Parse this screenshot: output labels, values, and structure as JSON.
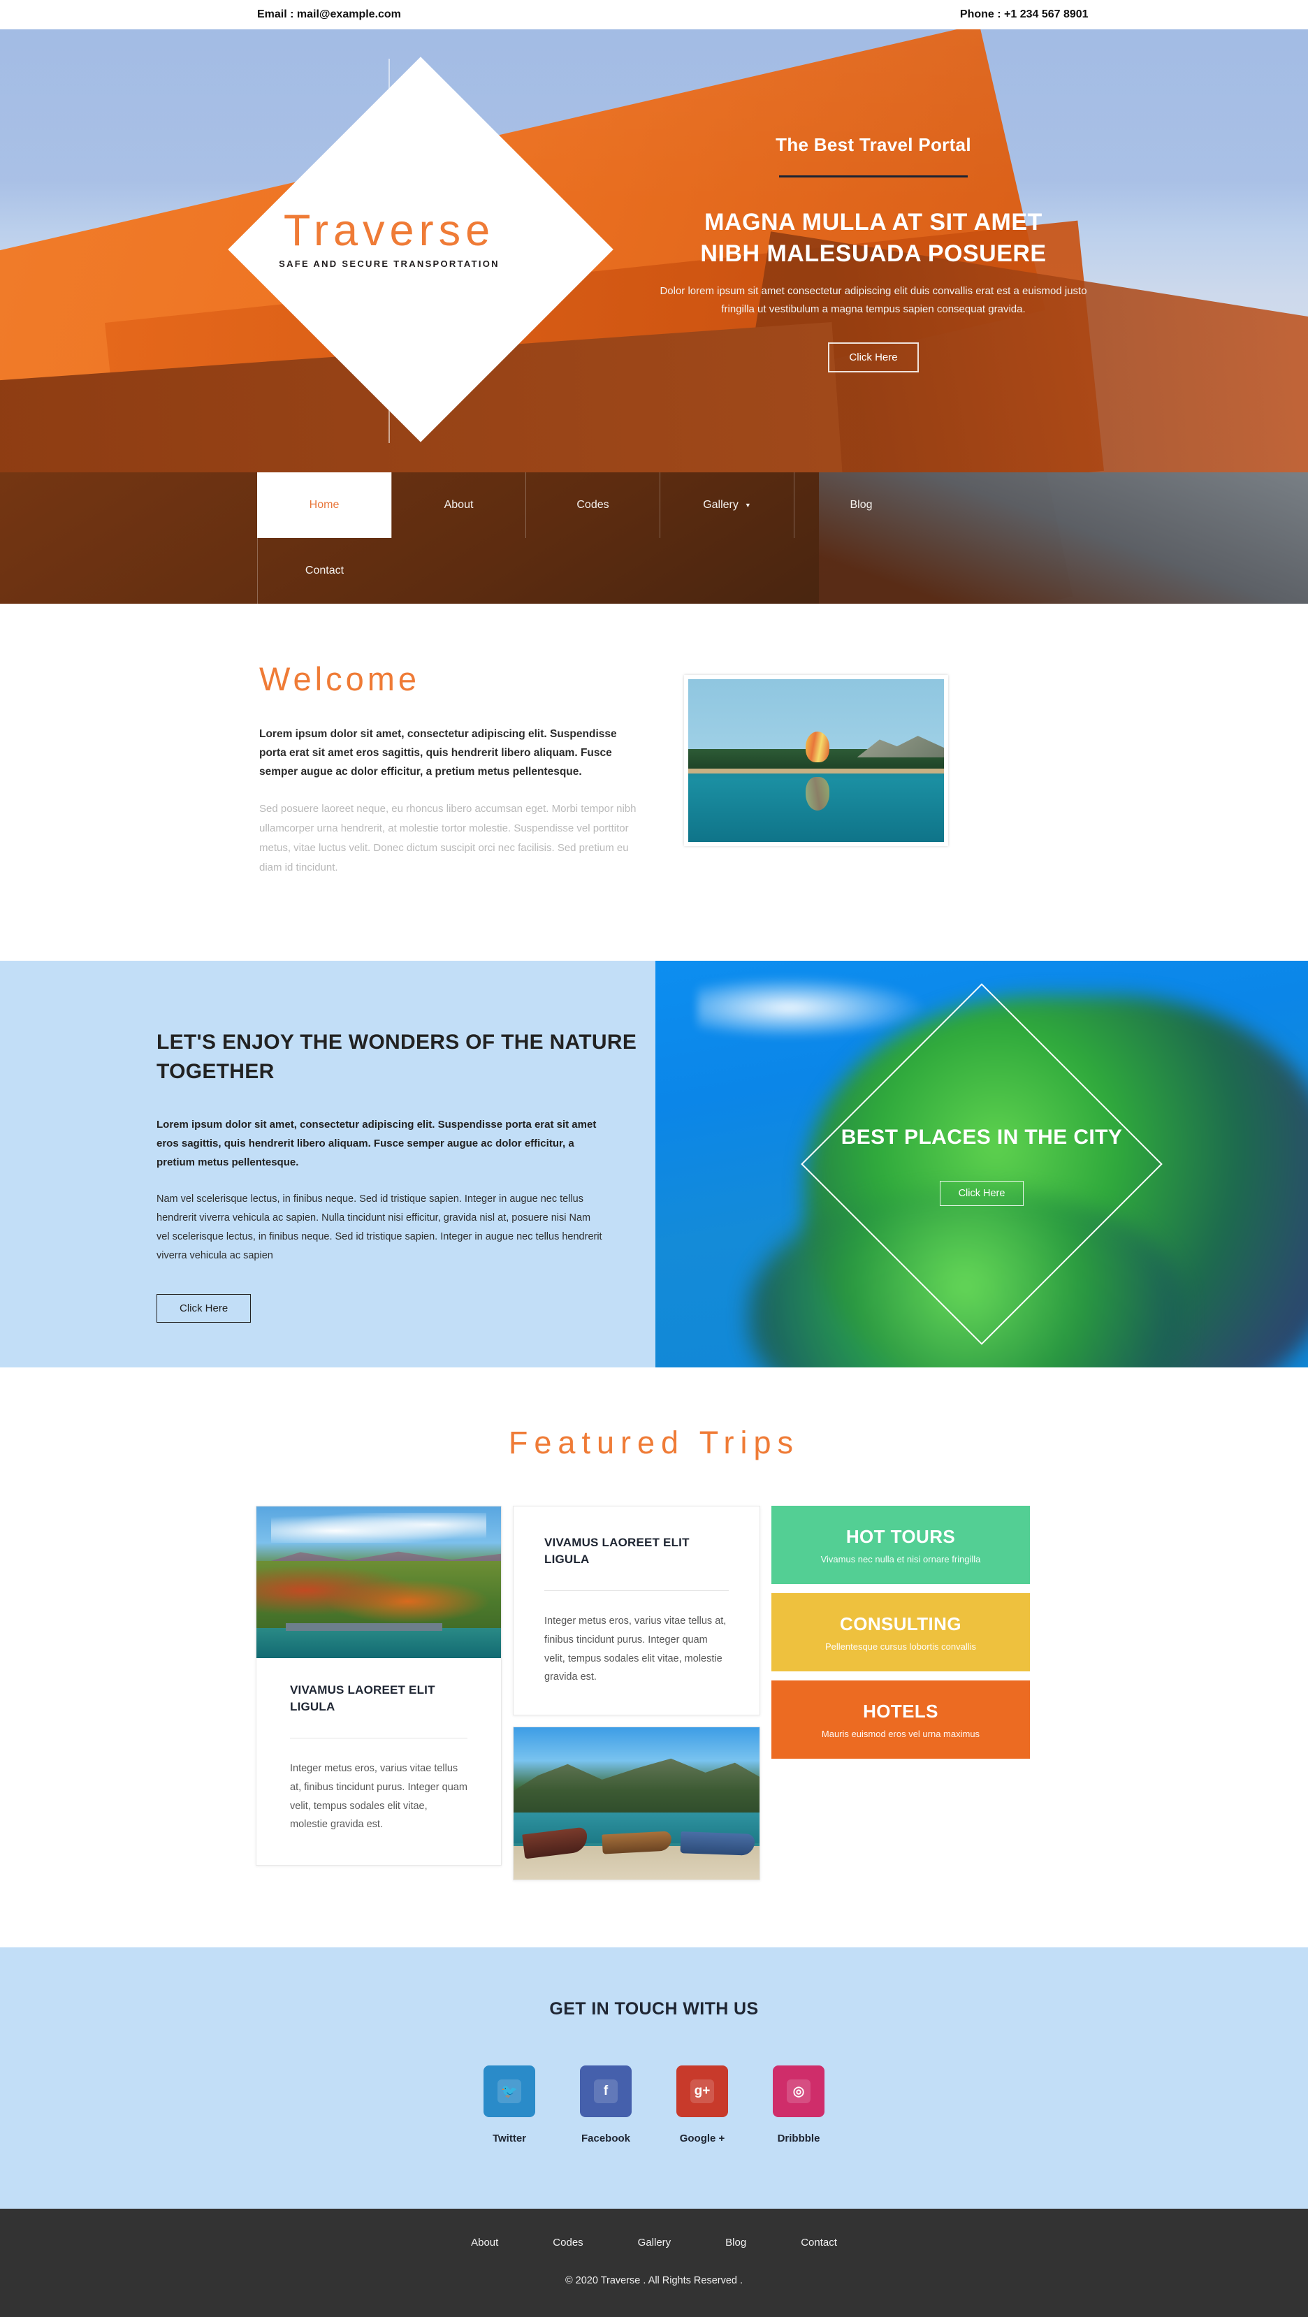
{
  "topbar": {
    "email": "Email : mail@example.com",
    "phone": "Phone : +1 234 567 8901"
  },
  "logo": {
    "name": "Traverse",
    "tagline": "SAFE AND SECURE TRANSPORTATION"
  },
  "hero": {
    "kicker": "The Best Travel Portal",
    "heading_line1": "MAGNA MULLA AT SIT AMET",
    "heading_line2": "NIBH MALESUADA POSUERE",
    "paragraph": "Dolor lorem ipsum sit amet consectetur adipiscing elit duis convallis erat est a euismod justo fringilla ut vestibulum a magna tempus sapien consequat gravida.",
    "button": "Click Here"
  },
  "nav": {
    "items": [
      {
        "label": "Home",
        "active": true,
        "caret": false
      },
      {
        "label": "About",
        "active": false,
        "caret": false
      },
      {
        "label": "Codes",
        "active": false,
        "caret": false
      },
      {
        "label": "Gallery",
        "active": false,
        "caret": true
      },
      {
        "label": "Blog",
        "active": false,
        "caret": false
      },
      {
        "label": "Contact",
        "active": false,
        "caret": false
      }
    ],
    "caret_glyph": "▼"
  },
  "welcome": {
    "heading": "Welcome",
    "lead": "Lorem ipsum dolor sit amet, consectetur adipiscing elit. Suspendisse porta erat sit amet eros sagittis, quis hendrerit libero aliquam. Fusce semper augue ac dolor efficitur, a pretium metus pellentesque.",
    "body": "Sed posuere laoreet neque, eu rhoncus libero accumsan eget. Morbi tempor nibh ullamcorper urna hendrerit, at molestie tortor molestie. Suspendisse vel porttitor metus, vitae luctus velit. Donec dictum suscipit orci nec facilisis. Sed pretium eu diam id tincidunt.",
    "image_alt": "hot-air-balloon-over-lake"
  },
  "wonders": {
    "heading": "LET'S ENJOY THE WONDERS OF THE NATURE TOGETHER",
    "lead": "Lorem ipsum dolor sit amet, consectetur adipiscing elit. Suspendisse porta erat sit amet eros sagittis, quis hendrerit libero aliquam. Fusce semper augue ac dolor efficitur, a pretium metus pellentesque.",
    "body": "Nam vel scelerisque lectus, in finibus neque. Sed id tristique sapien. Integer in augue nec tellus hendrerit viverra vehicula ac sapien. Nulla tincidunt nisi efficitur, gravida nisl at, posuere nisi Nam vel scelerisque lectus, in finibus neque. Sed id tristique sapien. Integer in augue nec tellus hendrerit viverra vehicula ac sapien",
    "button": "Click Here",
    "promo_heading": "BEST PLACES IN THE CITY",
    "promo_button": "Click Here",
    "promo_image_alt": "tropical-island-cliff"
  },
  "featured": {
    "heading": "Featured Trips",
    "card_left": {
      "title": "VIVAMUS LAOREET ELIT LIGULA",
      "text": "Integer metus eros, varius vitae tellus at, finibus tincidunt purus. Integer quam velit, tempus sodales elit vitae, molestie gravida est.",
      "image_alt": "autumn-mountain-bridge"
    },
    "card_middle": {
      "title": "VIVAMUS LAOREET ELIT LIGULA",
      "text": "Integer metus eros, varius vitae tellus at, finibus tincidunt purus. Integer quam velit, tempus sodales elit vitae, molestie gravida est.",
      "image_alt": "longtail-boats-beach"
    },
    "services": [
      {
        "title": "HOT TOURS",
        "subtitle": "Vivamus nec nulla et nisi ornare fringilla",
        "color": "#53cf94"
      },
      {
        "title": "CONSULTING",
        "subtitle": "Pellentesque cursus lobortis convallis",
        "color": "#eec13e"
      },
      {
        "title": "HOTELS",
        "subtitle": "Mauris euismod eros vel urna maximus",
        "color": "#ec6b22"
      }
    ]
  },
  "touch": {
    "heading": "GET IN TOUCH WITH US",
    "socials": [
      {
        "label": "Twitter",
        "icon": "twitter-icon",
        "glyph": "🐦",
        "color": "#2a8bc9"
      },
      {
        "label": "Facebook",
        "icon": "facebook-icon",
        "glyph": "f",
        "color": "#4560ac"
      },
      {
        "label": "Google +",
        "icon": "google-plus-icon",
        "glyph": "g+",
        "color": "#c83a2b"
      },
      {
        "label": "Dribbble",
        "icon": "dribbble-icon",
        "glyph": "◎",
        "color": "#cf2d6a"
      }
    ]
  },
  "footer": {
    "links": [
      "About",
      "Codes",
      "Gallery",
      "Blog",
      "Contact"
    ],
    "copyright": "© 2020 Traverse . All Rights Reserved ."
  },
  "colors": {
    "accent_orange": "#ef7b36",
    "light_blue": "#c2def7",
    "footer_dark": "#333333"
  }
}
